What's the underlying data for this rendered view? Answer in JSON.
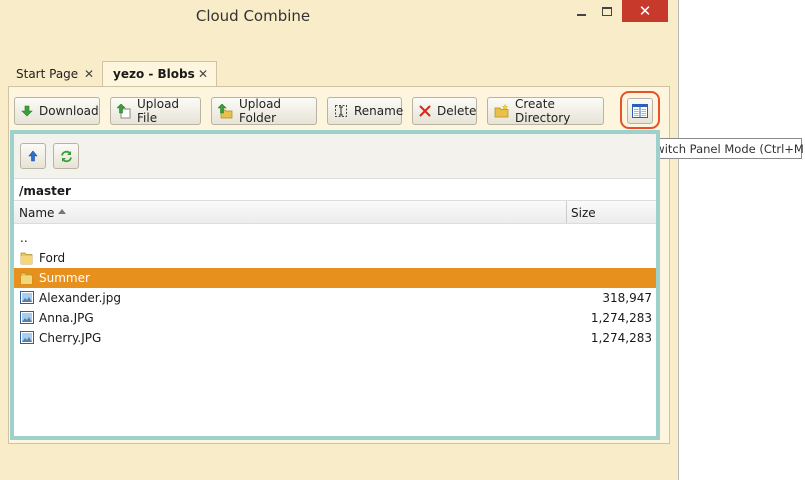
{
  "window": {
    "title": "Cloud Combine",
    "close_glyph": "✕"
  },
  "tabs": [
    {
      "label": "Start Page",
      "close": "✕"
    },
    {
      "label": "yezo - Blobs",
      "close": "✕"
    }
  ],
  "toolbar": {
    "download": "Download",
    "upload_file": "Upload File",
    "upload_folder": "Upload Folder",
    "rename": "Rename",
    "delete": "Delete",
    "create_directory": "Create Directory"
  },
  "tooltip": "Switch Panel Mode (Ctrl+M)",
  "panel": {
    "path": "/master",
    "columns": {
      "name": "Name",
      "size": "Size"
    },
    "items": [
      {
        "name": "..",
        "size": "",
        "kind": "parent"
      },
      {
        "name": "Ford",
        "size": "",
        "kind": "folder"
      },
      {
        "name": "Summer",
        "size": "",
        "kind": "folder"
      },
      {
        "name": "Alexander.jpg",
        "size": "318,947",
        "kind": "image"
      },
      {
        "name": "Anna.JPG",
        "size": "1,274,283",
        "kind": "image"
      },
      {
        "name": "Cherry.JPG",
        "size": "1,274,283",
        "kind": "image"
      }
    ]
  },
  "colors": {
    "window_bg": "#f9ecc9",
    "selection": "#e8901e",
    "panel_border": "#9ed0cc",
    "highlight_ring": "#e8522a",
    "close_button": "#c7392b"
  },
  "icons": {
    "download": "download-arrow-icon",
    "upload_file": "upload-file-icon",
    "upload_folder": "upload-folder-icon",
    "rename": "rename-icon",
    "delete": "delete-x-icon",
    "create_directory": "create-directory-icon",
    "switch_panel": "panel-mode-icon",
    "up": "up-directory-icon",
    "refresh": "refresh-icon",
    "folder": "folder-icon",
    "image": "image-file-icon"
  }
}
